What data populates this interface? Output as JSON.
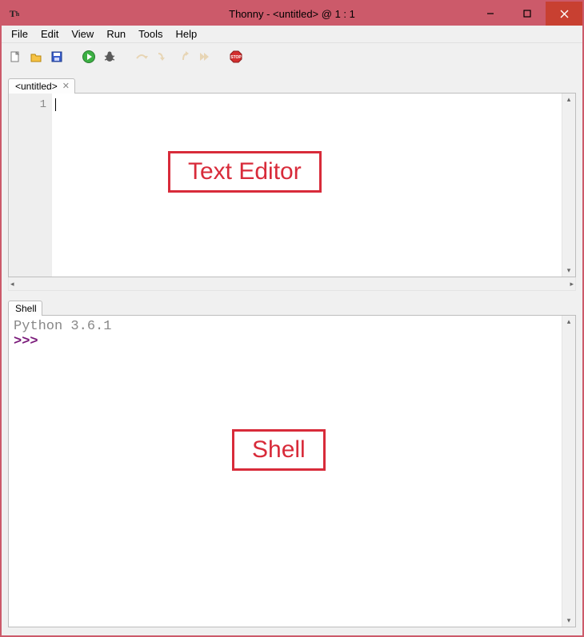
{
  "window": {
    "title": "Thonny  -  <untitled>  @  1 : 1"
  },
  "menubar": {
    "items": [
      "File",
      "Edit",
      "View",
      "Run",
      "Tools",
      "Help"
    ]
  },
  "toolbar": {
    "new_tooltip": "New",
    "open_tooltip": "Open",
    "save_tooltip": "Save",
    "run_tooltip": "Run",
    "debug_tooltip": "Debug",
    "step_over_tooltip": "Step over",
    "step_into_tooltip": "Step into",
    "step_out_tooltip": "Step out",
    "resume_tooltip": "Resume",
    "stop_tooltip": "Stop"
  },
  "editor": {
    "tab_label": "<untitled>",
    "line_number": "1"
  },
  "shell": {
    "tab_label": "Shell",
    "banner": "Python 3.6.1",
    "prompt": ">>>"
  },
  "annotations": {
    "editor_label": "Text Editor",
    "shell_label": "Shell"
  }
}
